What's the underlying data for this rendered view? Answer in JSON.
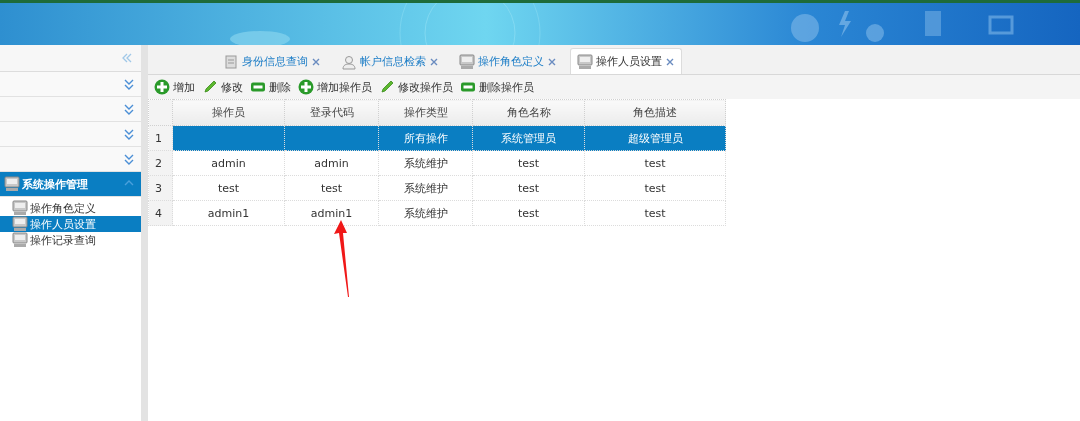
{
  "sidebar": {
    "groups": [
      {
        "expanded": false,
        "selected": false
      },
      {
        "expanded": false,
        "selected": false
      },
      {
        "expanded": false,
        "selected": false
      },
      {
        "expanded": false,
        "selected": false
      },
      {
        "label": "系统操作管理",
        "expanded": true,
        "selected": true,
        "children": [
          {
            "label": "操作角色定义",
            "selected": false
          },
          {
            "label": "操作人员设置",
            "selected": true
          },
          {
            "label": "操作记录查询",
            "selected": false
          }
        ]
      }
    ]
  },
  "tabs": [
    {
      "label": "身份信息查询",
      "kind": "page",
      "selected": false
    },
    {
      "label": "帐户信息检索",
      "kind": "user",
      "selected": false
    },
    {
      "label": "操作角色定义",
      "kind": "monitor",
      "selected": false
    },
    {
      "label": "操作人员设置",
      "kind": "monitor",
      "selected": true
    }
  ],
  "toolbar": [
    {
      "label": "增加",
      "kind": "add"
    },
    {
      "label": "修改",
      "kind": "edit"
    },
    {
      "label": "删除",
      "kind": "remove"
    },
    {
      "label": "增加操作员",
      "kind": "add"
    },
    {
      "label": "修改操作员",
      "kind": "edit"
    },
    {
      "label": "删除操作员",
      "kind": "remove"
    }
  ],
  "table": {
    "columns": [
      "操作员",
      "登录代码",
      "操作类型",
      "角色名称",
      "角色描述"
    ],
    "rows": [
      {
        "number": "1",
        "selected": true,
        "cells": [
          null,
          null,
          "所有操作",
          "系统管理员",
          "超级管理员"
        ]
      },
      {
        "number": "2",
        "selected": false,
        "cells": [
          "admin",
          "admin",
          "系统维护",
          "test",
          "test"
        ]
      },
      {
        "number": "3",
        "selected": false,
        "cells": [
          "test",
          "test",
          "系统维护",
          "test",
          "test"
        ]
      },
      {
        "number": "4",
        "selected": false,
        "cells": [
          "admin1",
          "admin1",
          "系统维护",
          "test",
          "test"
        ]
      }
    ]
  }
}
